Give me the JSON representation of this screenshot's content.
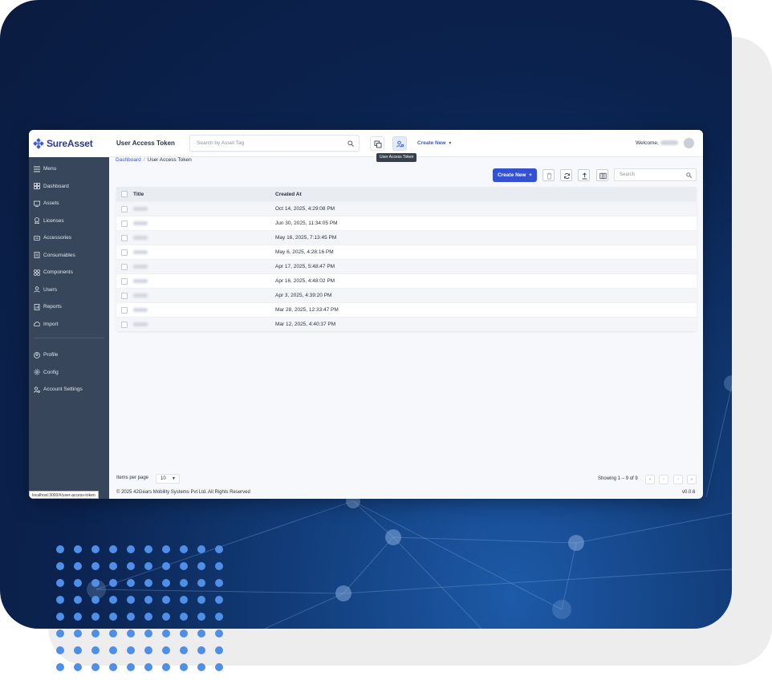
{
  "app": {
    "logo_text": "SureAsset",
    "status_url": "localhost:3000/#/user-access-token"
  },
  "sidebar": {
    "items": [
      {
        "label": "Menu",
        "icon": "menu-icon"
      },
      {
        "label": "Dashboard",
        "icon": "dashboard-icon"
      },
      {
        "label": "Assets",
        "icon": "assets-icon"
      },
      {
        "label": "Licenses",
        "icon": "license-icon"
      },
      {
        "label": "Accessories",
        "icon": "accessories-icon"
      },
      {
        "label": "Consumables",
        "icon": "consumables-icon"
      },
      {
        "label": "Components",
        "icon": "components-icon"
      },
      {
        "label": "Users",
        "icon": "users-icon"
      },
      {
        "label": "Reports",
        "icon": "reports-icon"
      },
      {
        "label": "Import",
        "icon": "import-icon"
      }
    ],
    "bottom_items": [
      {
        "label": "Profile",
        "icon": "profile-icon"
      },
      {
        "label": "Config",
        "icon": "gear-icon"
      },
      {
        "label": "Account Settings",
        "icon": "account-settings-icon"
      }
    ]
  },
  "header": {
    "title": "User Access Token",
    "search_placeholder": "Search by Asset Tag",
    "create_new_label": "Create New",
    "tooltip": "User Access Token",
    "welcome_label": "Welcome,"
  },
  "breadcrumb": {
    "root": "Dashboard",
    "separator": "/",
    "current": "User Access Token"
  },
  "toolbar": {
    "create_label": "Create New",
    "create_plus": "+",
    "search_placeholder": "Search"
  },
  "table": {
    "columns": [
      "Title",
      "Created At"
    ],
    "rows": [
      {
        "created_at": "Oct 14, 2025, 4:29:08 PM"
      },
      {
        "created_at": "Jun 30, 2025, 11:34:05 PM"
      },
      {
        "created_at": "May 16, 2025, 7:13:45 PM"
      },
      {
        "created_at": "May 6, 2025, 4:28:16 PM"
      },
      {
        "created_at": "Apr 17, 2025, 5:48:47 PM"
      },
      {
        "created_at": "Apr 16, 2025, 4:48:02 PM"
      },
      {
        "created_at": "Apr 3, 2025, 4:39:20 PM"
      },
      {
        "created_at": "Mar 28, 2025, 12:33:47 PM"
      },
      {
        "created_at": "Mar 12, 2025, 4:40:37 PM"
      }
    ]
  },
  "footer": {
    "items_per_page_label": "Items per page",
    "items_per_page_value": "10",
    "showing_text": "Showing 1 – 9 of 9",
    "pager_first": "«",
    "pager_prev": "‹",
    "pager_next": "›",
    "pager_last": "»",
    "copyright": "© 2025 42Gears Mobility Systems Pvt Ltd. All Rights Reserved",
    "version": "v0.0.6"
  },
  "colors": {
    "primary": "#3451d1",
    "sidebar_bg": "#38465b",
    "backdrop_navy": "#0a1b3f",
    "dot_blue": "#4f8fe8"
  }
}
